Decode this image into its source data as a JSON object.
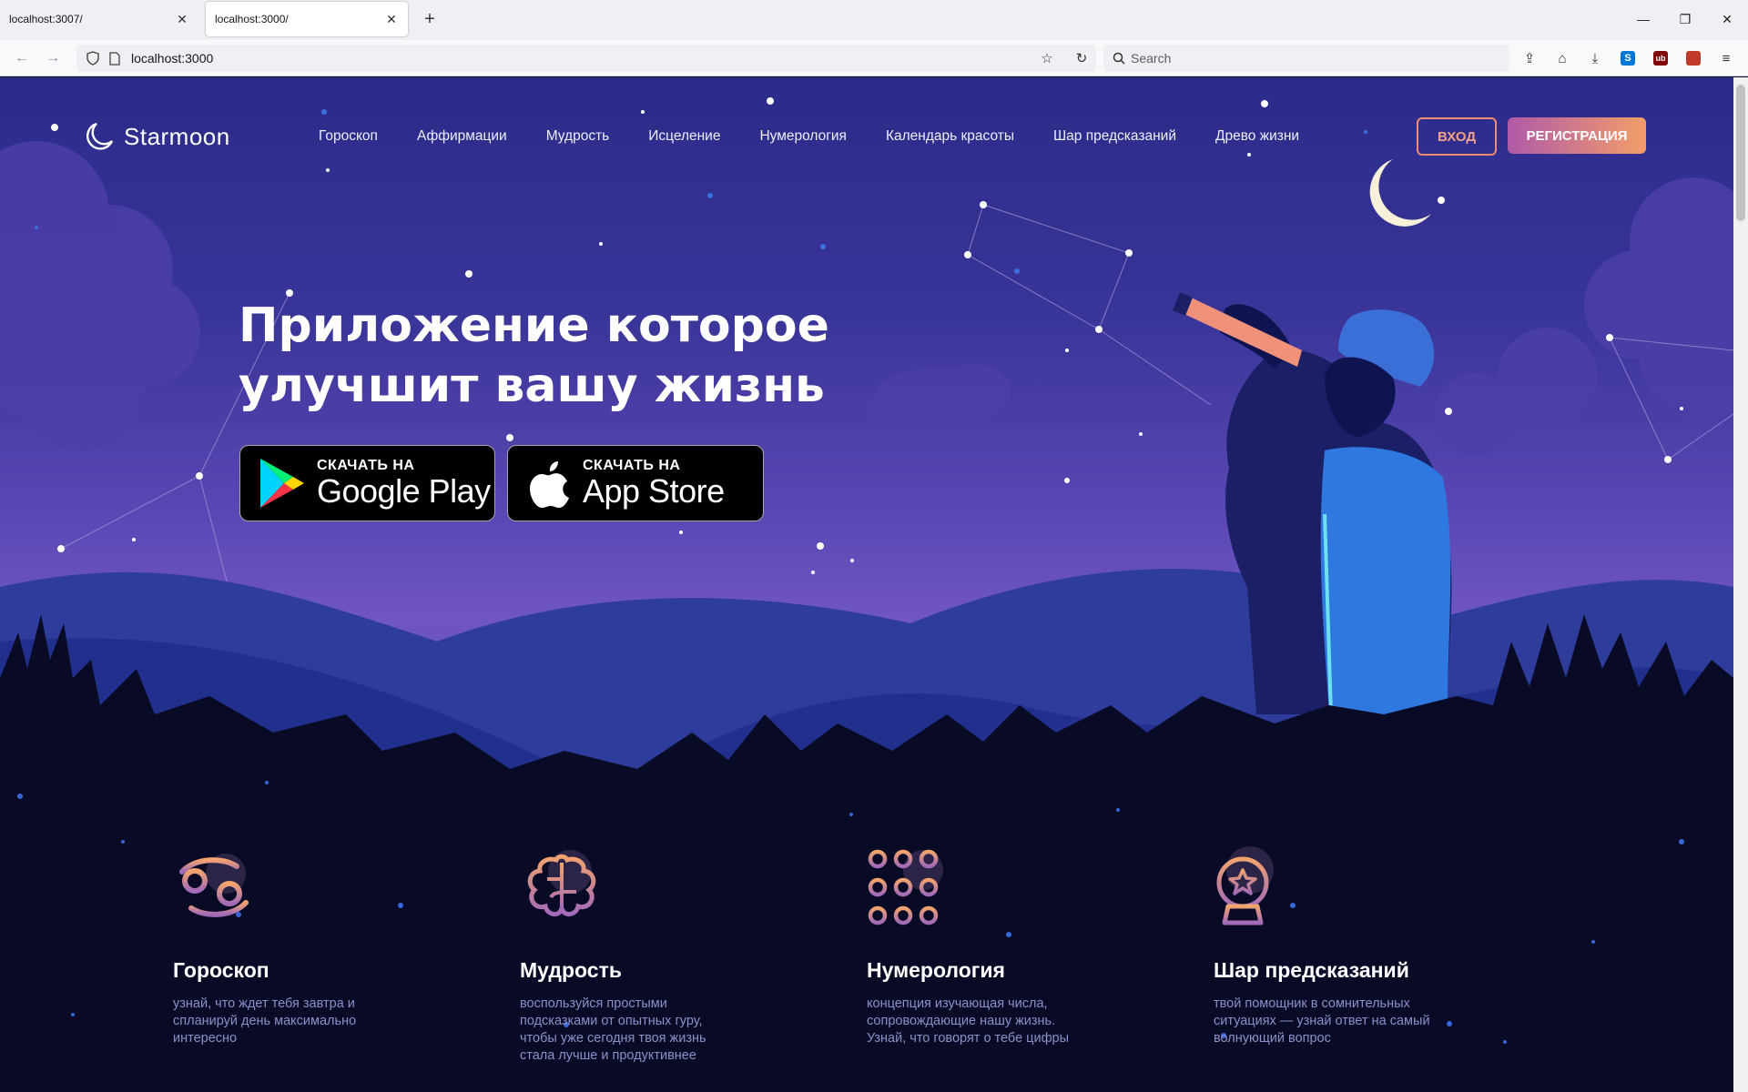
{
  "browser": {
    "tabs": [
      {
        "title": "localhost:3007/",
        "active": false
      },
      {
        "title": "localhost:3000/",
        "active": true
      }
    ],
    "url": "localhost:3000",
    "search_placeholder": "Search"
  },
  "site": {
    "brand": "Starmoon",
    "menu": [
      "Гороскоп",
      "Аффирмации",
      "Мудрость",
      "Исцеление",
      "Нумерология",
      "Календарь красоты",
      "Шар предсказаний",
      "Древо жизни"
    ],
    "login_label": "ВХОД",
    "register_label": "РЕГИСТРАЦИЯ",
    "headline_line1": "Приложение которое",
    "headline_line2": "улучшит вашу жизнь",
    "google_play": {
      "small": "СКАЧАТЬ НА",
      "big": "Google Play"
    },
    "app_store": {
      "small": "СКАЧАТЬ НА",
      "big": "App Store"
    }
  },
  "features": [
    {
      "title": "Гороскоп",
      "text": "узнай, что ждет тебя завтра и спланируй день максимально интересно",
      "icon": "cancer-zodiac-icon"
    },
    {
      "title": "Мудрость",
      "text": "воспользуйся простыми подсказками от опытных гуру, чтобы уже сегодня твоя жизнь стала лучше и продуктивнее",
      "icon": "brain-icon"
    },
    {
      "title": "Нумерология",
      "text": "концепция изучающая числа, сопровождающие нашу жизнь. Узнай, что говорят о тебе цифры",
      "icon": "number-grid-icon"
    },
    {
      "title": "Шар предсказаний",
      "text": "твой помощник в сомнительных ситуациях — узнай ответ на самый волнующий вопрос",
      "icon": "crystal-ball-icon"
    }
  ],
  "colors": {
    "accent_orange": "#f38b73",
    "hero_top": "#2b2b89",
    "hero_mid": "#7156c2",
    "footer_bg": "#090b26"
  }
}
